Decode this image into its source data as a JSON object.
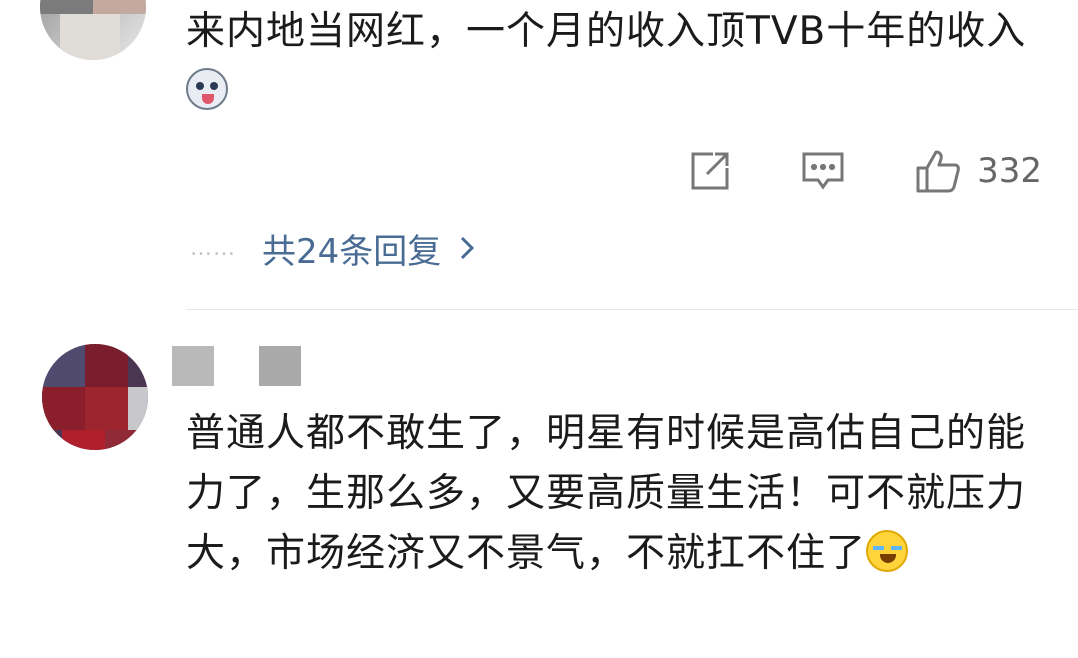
{
  "comments": [
    {
      "text": "来内地当网红，一个月的收入顶TVB十年的收入",
      "emoji": "husky-emoji",
      "like_count": "332",
      "replies_label": "共24条回复",
      "more_dots": "……"
    },
    {
      "text": "普通人都不敢生了，明星有时候是高估自己的能力了，生那么多，又要高质量生活！可不就压力大，市场经济又不景气，不就扛不住了",
      "emoji": "crying-laughing-emoji"
    }
  ],
  "icons": {
    "share": "share-icon",
    "comment": "comment-icon",
    "like": "thumbs-up-icon",
    "chevron": "chevron-right-icon"
  },
  "colors": {
    "link": "#4a6c94",
    "icon": "#777777",
    "text": "#1b1b1b"
  }
}
